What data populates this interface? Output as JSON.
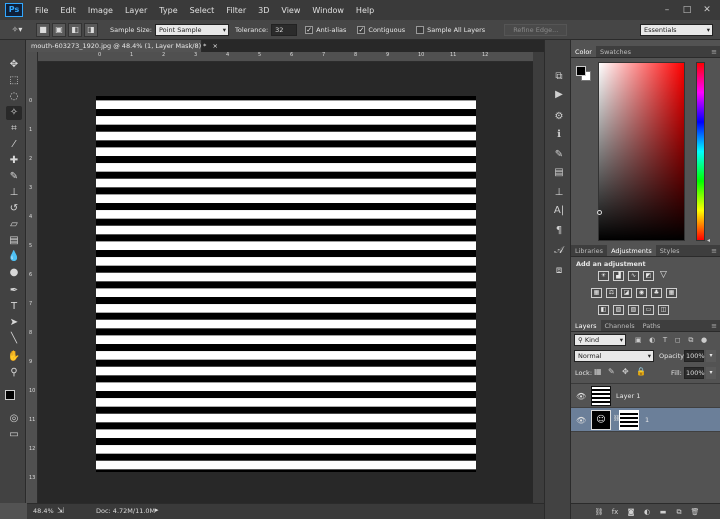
{
  "app": {
    "logo": "Ps"
  },
  "menu": [
    "File",
    "Edit",
    "Image",
    "Layer",
    "Type",
    "Select",
    "Filter",
    "3D",
    "View",
    "Window",
    "Help"
  ],
  "window_controls": [
    "–",
    "□",
    "✕"
  ],
  "options": {
    "sample_size_label": "Sample Size:",
    "sample_size_value": "Point Sample",
    "tolerance_label": "Tolerance:",
    "tolerance_value": "32",
    "antialias_label": "Anti-alias",
    "contiguous_label": "Contiguous",
    "sample_all_label": "Sample All Layers",
    "refine_edge_label": "Refine Edge...",
    "workspace": "Essentials"
  },
  "document": {
    "tab_title": "mouth-603273_1920.jpg @ 48.4% (1, Layer Mask/8) *",
    "tab_close": "×",
    "stripe_count": 24,
    "colors": {
      "stripe_white": "#ffffff",
      "stripe_black": "#000000"
    }
  },
  "rulers": {
    "top_ticks": [
      "0",
      "1",
      "2",
      "3",
      "4",
      "5",
      "6",
      "7",
      "8",
      "9",
      "10",
      "11",
      "12"
    ],
    "left_ticks": [
      "0",
      "1",
      "2",
      "3",
      "4",
      "5",
      "6",
      "7",
      "8",
      "9",
      "10",
      "11",
      "12",
      "13"
    ]
  },
  "status": {
    "zoom": "48.4%",
    "doc": "Doc: 4.72M/11.0M"
  },
  "color_panel": {
    "tabs": [
      "Color",
      "Swatches"
    ]
  },
  "adjustments_panel": {
    "tabs": [
      "Libraries",
      "Adjustments",
      "Styles"
    ],
    "heading": "Add an adjustment"
  },
  "layers_panel": {
    "tabs": [
      "Layers",
      "Channels",
      "Paths"
    ],
    "filter": "Kind",
    "blend_mode": "Normal",
    "opacity_label": "Opacity:",
    "opacity_value": "100%",
    "lock_label": "Lock:",
    "fill_label": "Fill:",
    "fill_value": "100%",
    "layers": [
      {
        "name": "Layer 1",
        "selected": false
      },
      {
        "name": "1",
        "selected": true
      }
    ],
    "bottom_icons": [
      "link-icon",
      "fx-icon",
      "add-mask-icon",
      "adjustment-layer-icon",
      "group-icon",
      "new-layer-icon",
      "trash-icon"
    ]
  },
  "accent": {
    "selected_layer": "#6b7f99",
    "hue_bar_top": "#ff0000"
  }
}
